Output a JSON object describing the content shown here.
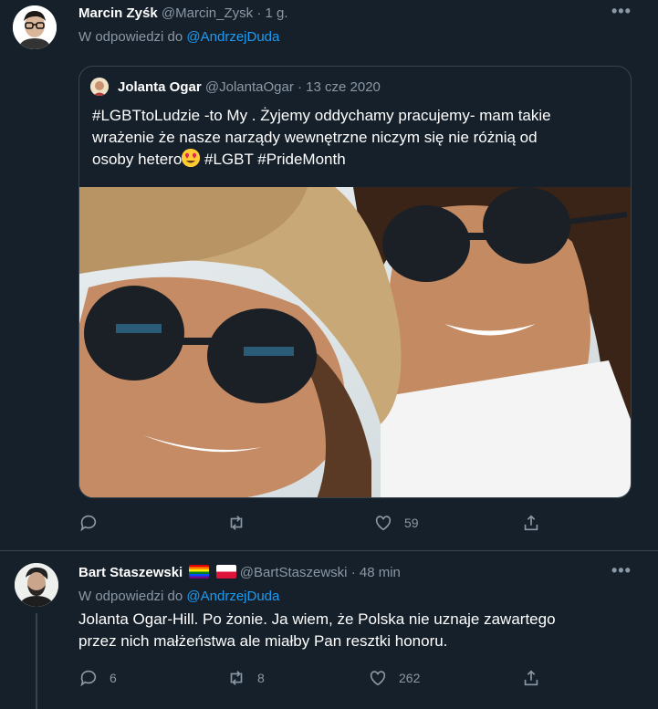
{
  "tweet1": {
    "name": "Marcin Zyśk",
    "handle": "@Marcin_Zysk",
    "sep": "·",
    "time": "1 g.",
    "replying_prefix": "W odpowiedzi do",
    "replying_to": "@AndrzejDuda",
    "quote": {
      "name": "Jolanta Ogar",
      "handle": "@JolantaOgar",
      "sep": "·",
      "date": "13 cze 2020",
      "text_line1": "#LGBTtoLudzie -to My . Żyjemy oddychamy pracujemy- mam takie",
      "text_line2": "wrażenie że nasze narządy wewnętrzne niczym się nie różnią od",
      "text_line3_a": "osoby hetero",
      "text_line3_b": " #LGBT #PrideMonth"
    },
    "actions": {
      "reply": "",
      "retweet": "",
      "likes": "59",
      "share": ""
    }
  },
  "tweet2": {
    "name": "Bart Staszewski",
    "handle": "@BartStaszewski",
    "sep": "·",
    "time": "48 min",
    "replying_prefix": "W odpowiedzi do",
    "replying_to": "@AndrzejDuda",
    "text_line1": "Jolanta Ogar-Hill. Po żonie. Ja wiem, że Polska nie uznaje zawartego",
    "text_line2": "przez nich małżeństwa ale miałby Pan resztki honoru.",
    "actions": {
      "replies": "6",
      "retweets": "8",
      "likes": "262",
      "share": ""
    }
  },
  "more_glyph": "•••",
  "colors": {
    "background": "#15202b",
    "link": "#1d9bf0",
    "muted": "#8b98a5",
    "border": "#38444d"
  }
}
